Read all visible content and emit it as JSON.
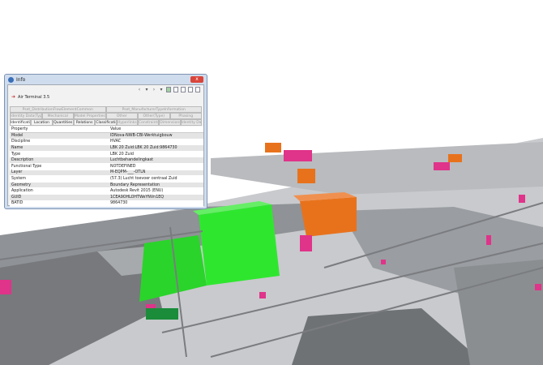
{
  "window": {
    "title": "Info",
    "close_label": "x"
  },
  "object": {
    "name": "Air Terminal 3.5"
  },
  "nav": [
    "‹",
    "▾",
    "›",
    "▾"
  ],
  "tabs": {
    "row1": [
      "Pset_DistributionFlowElementCommon",
      "Pset_ManufacturerTypeInformation"
    ],
    "row2": [
      "Identity Data(Type)",
      "Mechanical",
      "Model Properties(Type)",
      "Other",
      "Other(Type)",
      "Phasing"
    ],
    "row3": [
      "Identification",
      "Location",
      "Quantities",
      "Relations",
      "Classification",
      "Hyperlinks",
      "Constraints",
      "Dimensions",
      "Identity Data"
    ]
  },
  "table": {
    "headers": [
      "Property",
      "Value"
    ],
    "rows": [
      [
        "Model",
        "IDNova-NWB-CBI-Werktuigbouw"
      ],
      [
        "Discipline",
        "HVAC"
      ],
      [
        "Name",
        "LBK 20 Zuid:LBK 20 Zuid:9864730"
      ],
      [
        "Type",
        "LBK 20 Zuid"
      ],
      [
        "Description",
        "Luchtbehandelingkast"
      ],
      [
        "Functional Type",
        "NOTDEFINED"
      ],
      [
        "Layer",
        "M-EQPM-___-OTLN"
      ],
      [
        "System",
        "(57.3) Lucht toevoer centraal Zuid"
      ],
      [
        "Geometry",
        "Boundary Representation"
      ],
      [
        "Application",
        "Autodesk Revit 2015 (ENU)"
      ],
      [
        "GUID",
        "1CEA9OHLOHTWeYNVn1EQ"
      ],
      [
        "BATID",
        "9864730"
      ]
    ]
  },
  "colors": {
    "selected": "#33e633",
    "equipment": "#e8721c",
    "magenta": "#e0338a",
    "duct": "#a6a8ab"
  }
}
